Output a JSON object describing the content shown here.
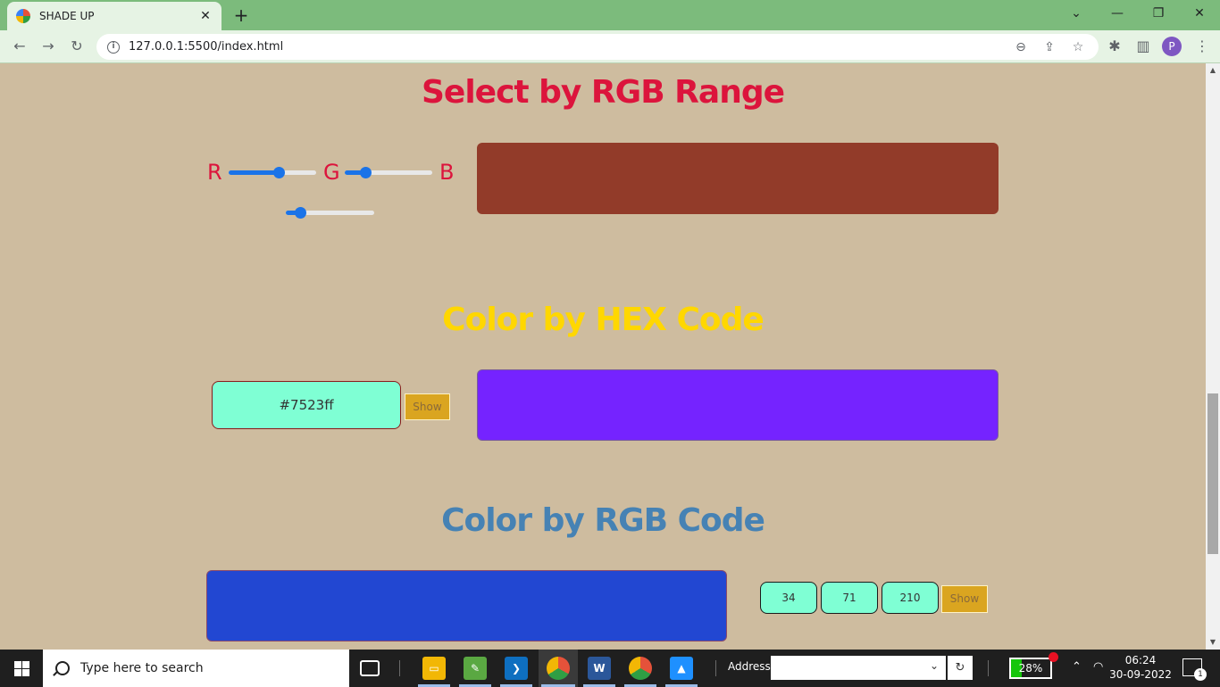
{
  "browser": {
    "tab_title": "SHADE UP",
    "url": "127.0.0.1:5500/index.html",
    "profile_initial": "P"
  },
  "sections": {
    "rgb_range": {
      "title": "Select by RGB Range",
      "channels": {
        "r": "R",
        "g": "G",
        "b": "B"
      },
      "slider_values": {
        "r": 146,
        "g": 59,
        "b": 41
      },
      "swatch_color": "#923b29"
    },
    "hex": {
      "title": "Color by HEX Code",
      "input_value": "#7523ff",
      "show_label": "Show",
      "swatch_color": "#7523ff"
    },
    "rgb_code": {
      "title": "Color by RGB Code",
      "r_value": "34",
      "g_value": "71",
      "b_value": "210",
      "show_label": "Show",
      "swatch_color": "#2247d2"
    }
  },
  "colors": {
    "page_bg": "#cebc9f",
    "heading_rgb_range": "#dc143c",
    "heading_hex": "#ffd700",
    "heading_rgb_code": "#4682b4",
    "input_bg": "#7fffd4",
    "button_bg": "#daa520"
  },
  "taskbar": {
    "search_placeholder": "Type here to search",
    "address_label": "Address",
    "battery_percent": "28%",
    "battery_level": 0.28,
    "time": "06:24",
    "date": "30-09-2022",
    "notification_count": "1",
    "pinned_apps": [
      "task-view",
      "file-explorer",
      "notepad",
      "vscode",
      "chrome-profile-p",
      "word",
      "chrome-profile-m",
      "photos"
    ]
  }
}
